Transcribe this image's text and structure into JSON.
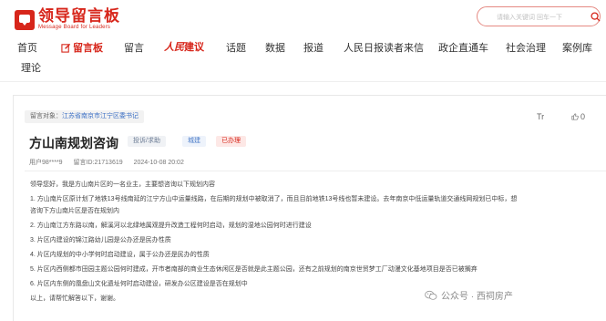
{
  "header": {
    "logo_cn": "领导留言板",
    "logo_en": "Message Board for Leaders",
    "search_placeholder": "请输入关键词 回车一下"
  },
  "nav": {
    "items": [
      "首页",
      "留言板",
      "留言",
      "人民建议",
      "话题",
      "数据",
      "报道",
      "人民日报读者来信",
      "政企直通车",
      "社会治理",
      "案例库",
      "理论"
    ],
    "rmrb_prefix": "人民",
    "rmrb_suffix": "建议"
  },
  "message": {
    "target_label": "留言对象：",
    "target_value": "江苏省南京市江宁区委书记",
    "title": "方山南规划咨询",
    "badges": [
      "投诉/求助",
      "城建",
      "已办理"
    ],
    "user": "用户98****9",
    "id_text": "留言ID:21713619",
    "time": "2024-10-08 20:02",
    "like_count": "0",
    "tr_label": "Tr",
    "body": [
      "领导您好，我是方山南片区的一名业主，主要想咨询以下规划内容",
      "1. 方山南片区原计划了地铁13号线南延的江宁方山中运量线路，在后期的规划中被取消了，而且目前地铁13号线也暂未建设。去年南京中低运量轨道交通线网规划已中标，想",
      "咨询下方山南片区是否在规划内",
      "2. 方山南江方东路以南，解溪河以北绿地属观提升改造工程何时启动，规划的湿地公园何时进行建设",
      "3. 片区内建设的锦江路幼儿园是公办还是民办性质",
      "4. 片区内规划的中小学何时启动建设，属于公办还是民办的性质",
      "5. 片区内西侧都市田园主题公园何时建成，开市者南部的商业生态休闲区是否就是此主题公园，还有之前规划的南京世贸梦工厂动漫文化基地项目是否已被搁弃",
      "6. 片区内东侧的凰盘山文化遗址何时启动建设，研发办公区建设是否在规划中",
      "以上，请帮忙解答以下，谢谢。"
    ]
  },
  "watermark": "公众号 · 西祠房产",
  "colors": {
    "brand": "#d7261b",
    "link": "#3b6fc4"
  }
}
